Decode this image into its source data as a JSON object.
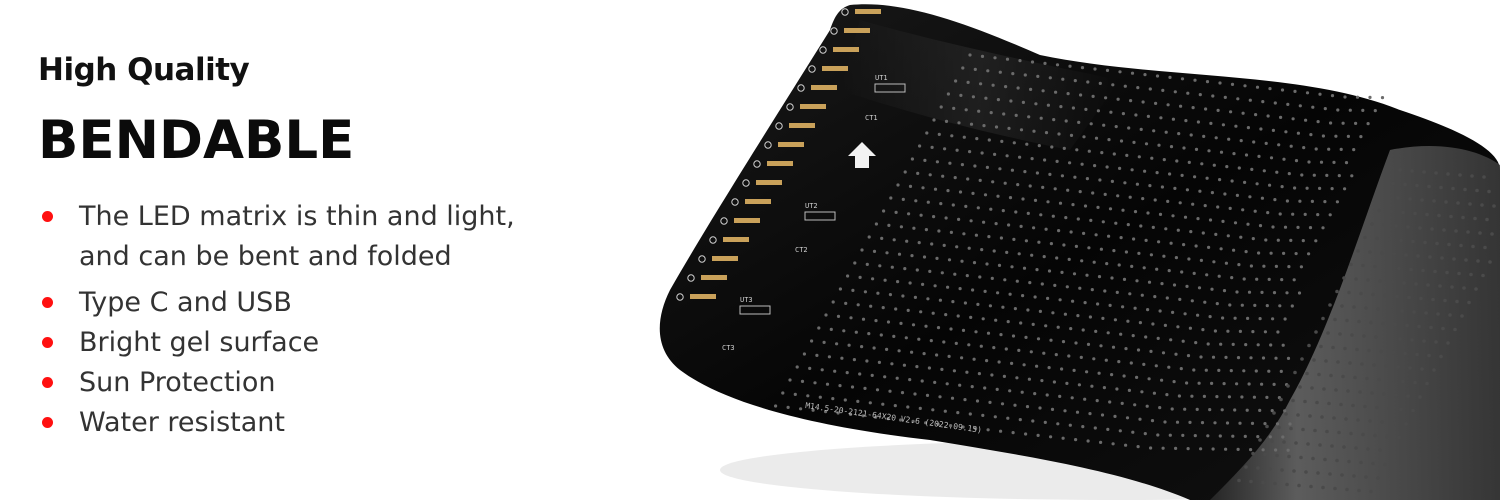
{
  "headline": {
    "subtitle": "High Quality",
    "title": "BENDABLE"
  },
  "features": [
    {
      "line1": "The LED matrix is thin and light,",
      "line2": "and can be bent and folded"
    },
    {
      "line1": "Type C and USB"
    },
    {
      "line1": "Bright gel surface"
    },
    {
      "line1": "Sun Protection"
    },
    {
      "line1": "Water resistant"
    }
  ],
  "product": {
    "board_marking": "M14.5-20-2121-64X20 V2.6 (2022.09.15)",
    "chip_labels": [
      "UT1",
      "UT2",
      "UT3"
    ],
    "capacitor_labels": [
      "CT1",
      "CT2",
      "CT3"
    ]
  },
  "colors": {
    "bullet": "#ff1010",
    "board": "#0a0a0a",
    "text_heading": "#111111",
    "text_body": "#333333"
  },
  "icons": [
    "bullet-dot-icon",
    "up-arrow-icon"
  ]
}
